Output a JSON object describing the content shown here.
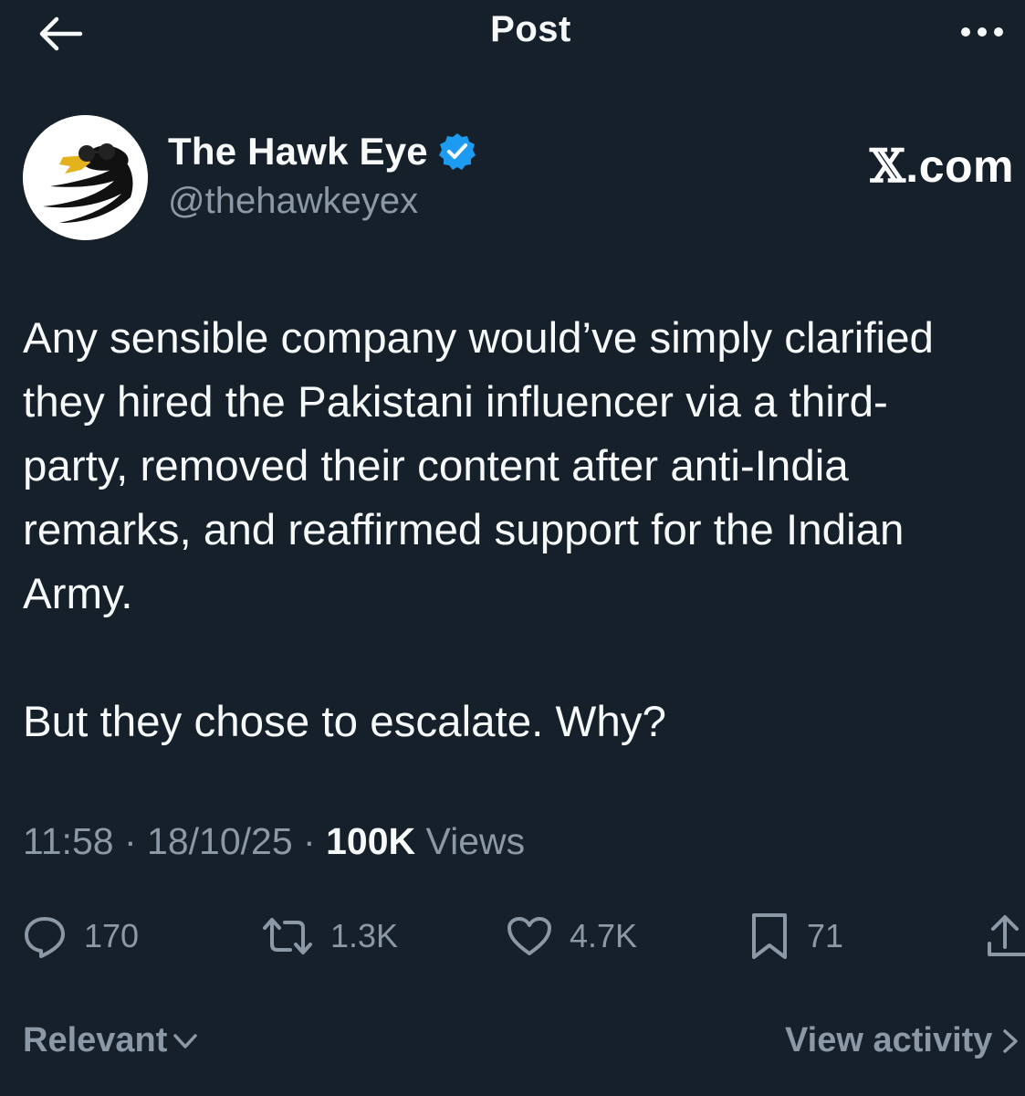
{
  "header": {
    "title": "Post",
    "back_icon": "arrow-left-icon",
    "more_icon": "ellipsis-icon"
  },
  "author": {
    "display_name": "The Hawk Eye",
    "handle": "@thehawkeyex",
    "verified": true,
    "verified_color": "#1d9bf0",
    "avatar_icon": "eagle-with-sunglasses-avatar"
  },
  "brand": {
    "x_glyph": "𝕏",
    "domain": ".com"
  },
  "post": {
    "text_1": "Any sensible company would’ve simply clarified\nthey hired the Pakistani influencer via a third-\nparty, removed their content after anti-India\nremarks, and reaffirmed support for the Indian\nArmy.",
    "text_2": "But they chose to escalate. Why?",
    "time": "11:58",
    "date": "18/10/25",
    "views_count": "100K",
    "views_label": "Views",
    "separator": "·"
  },
  "actions": {
    "replies": "170",
    "reposts": "1.3K",
    "likes": "4.7K",
    "bookmarks": "71",
    "reply_icon": "reply-bubble-icon",
    "repost_icon": "repost-icon",
    "like_icon": "heart-icon",
    "bookmark_icon": "bookmark-icon",
    "share_icon": "share-icon"
  },
  "footer": {
    "sort_label": "Relevant",
    "view_activity_label": "View activity"
  },
  "colors": {
    "background": "#15202b",
    "text_primary": "#f7f9f9",
    "text_secondary": "#8b98a5",
    "accent": "#1d9bf0"
  }
}
